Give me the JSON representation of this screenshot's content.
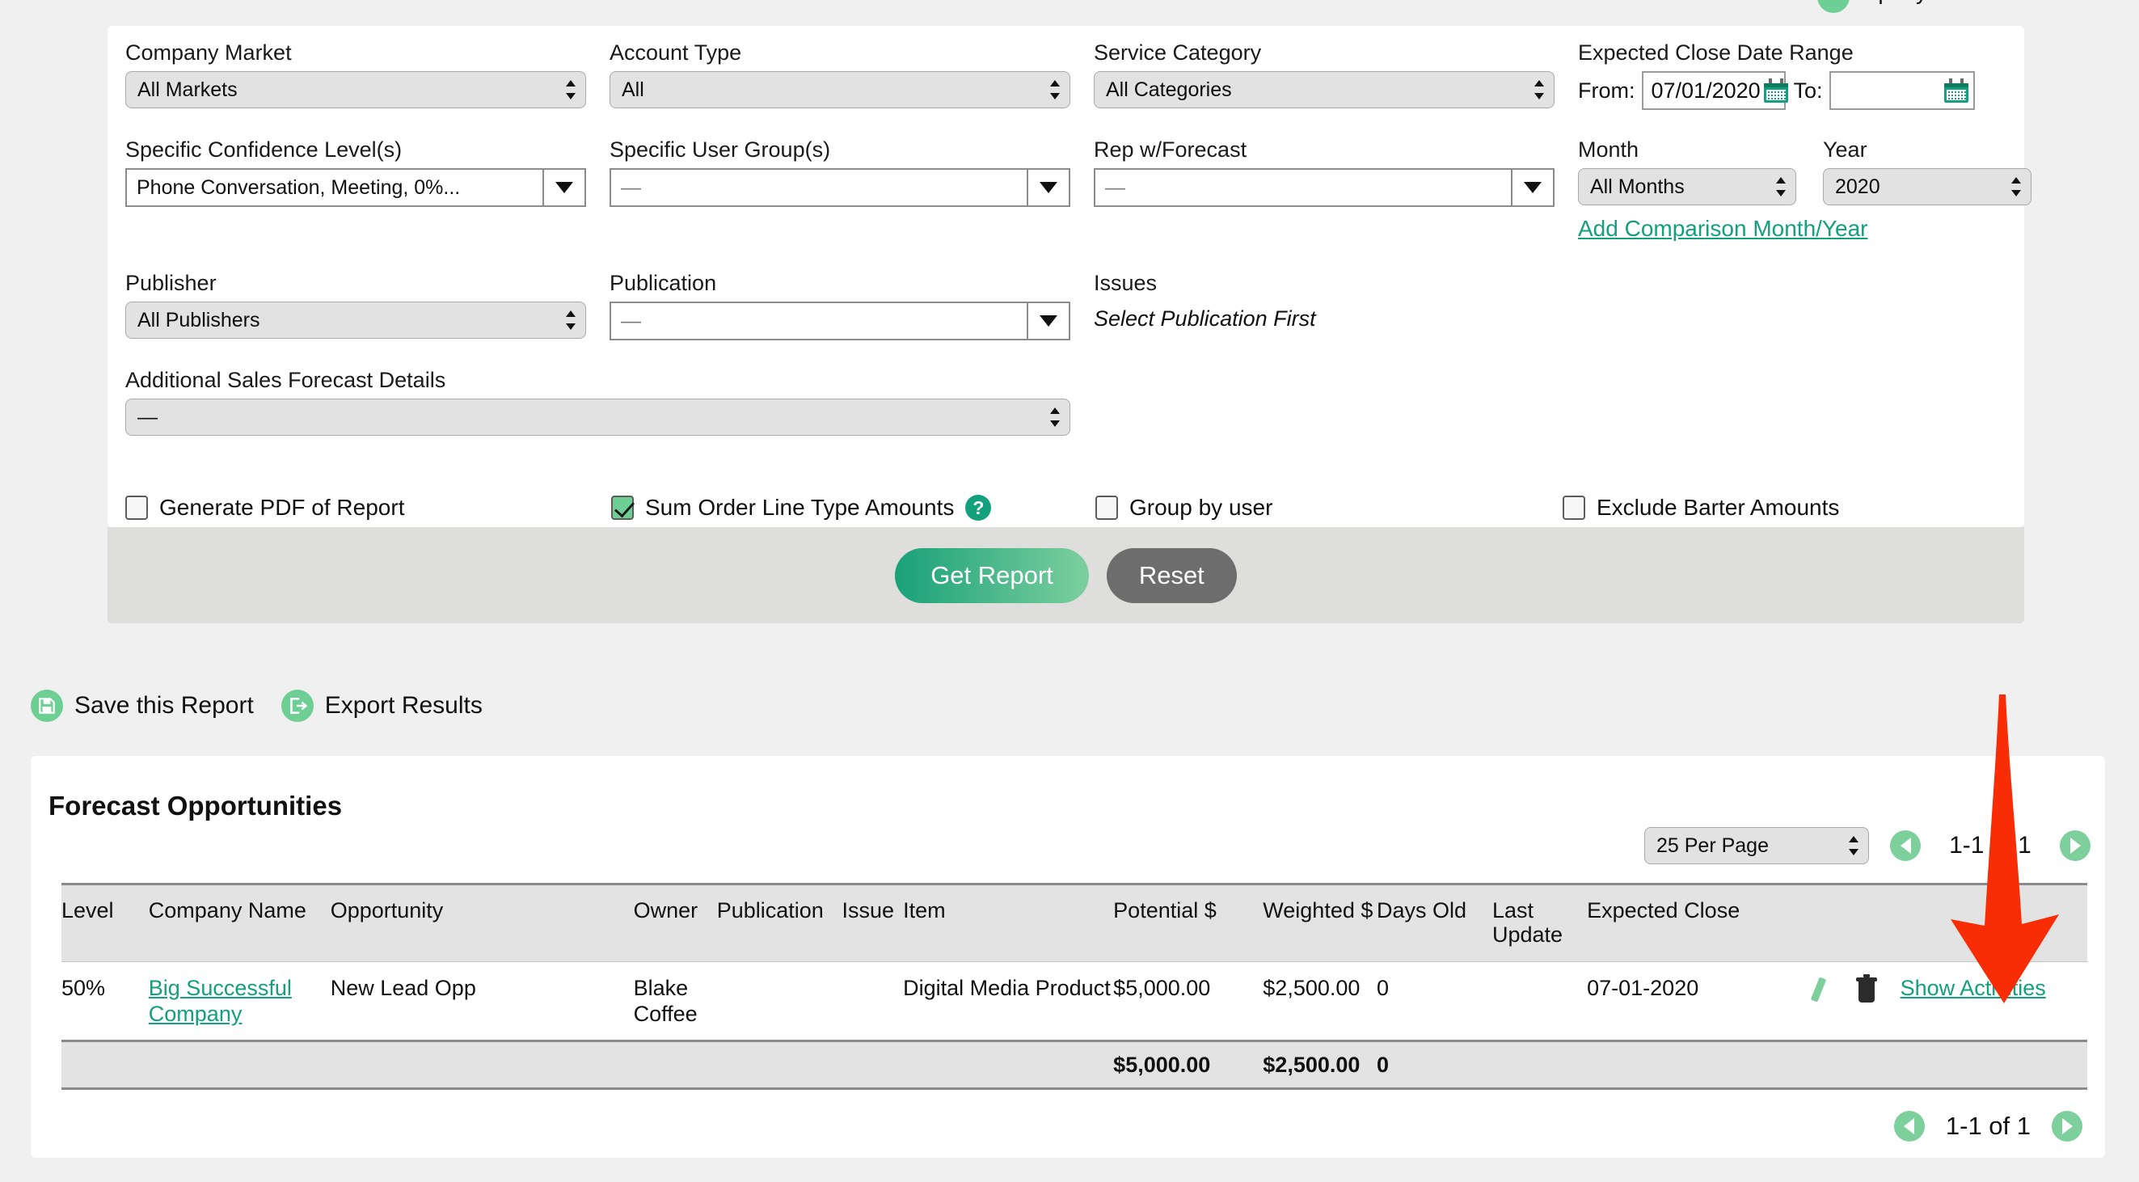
{
  "top_cut": {
    "label": "mpany"
  },
  "filters": {
    "company_market": {
      "label": "Company Market",
      "value": "All Markets"
    },
    "account_type": {
      "label": "Account Type",
      "value": "All"
    },
    "service_category": {
      "label": "Service Category",
      "value": "All Categories"
    },
    "expected_close": {
      "label": "Expected Close Date Range",
      "from_label": "From:",
      "from_value": "07/01/2020",
      "to_label": "To:",
      "to_value": ""
    },
    "confidence": {
      "label": "Specific Confidence Level(s)",
      "value": "Phone Conversation, Meeting, 0%..."
    },
    "user_groups": {
      "label": "Specific User Group(s)",
      "value": "—"
    },
    "rep_forecast": {
      "label": "Rep w/Forecast",
      "value": "—"
    },
    "month": {
      "label": "Month",
      "value": "All Months"
    },
    "year": {
      "label": "Year",
      "value": "2020"
    },
    "add_comparison": "Add Comparison Month/Year",
    "publisher": {
      "label": "Publisher",
      "value": "All Publishers"
    },
    "publication": {
      "label": "Publication",
      "value": "—"
    },
    "issues": {
      "label": "Issues",
      "note": "Select Publication First"
    },
    "additional_details": {
      "label": "Additional Sales Forecast Details",
      "value": "—"
    }
  },
  "checkboxes": [
    {
      "label": "Generate PDF of Report",
      "checked": false,
      "help": false
    },
    {
      "label": "Sum Order Line Type Amounts",
      "checked": true,
      "help": true,
      "help_glyph": "?"
    },
    {
      "label": "Group by user",
      "checked": false,
      "help": false
    },
    {
      "label": "Exclude Barter Amounts",
      "checked": false,
      "help": false
    }
  ],
  "buttons": {
    "get_report": "Get Report",
    "reset": "Reset"
  },
  "actions": [
    {
      "label": "Save this Report",
      "icon": "save-disk-icon"
    },
    {
      "label": "Export Results",
      "icon": "export-icon"
    }
  ],
  "results": {
    "title": "Forecast Opportunities",
    "per_page": "25 Per Page",
    "page_count_top": "1-1 of 1",
    "page_count_bottom": "1-1 of 1",
    "columns": [
      "Level",
      "Company Name",
      "Opportunity",
      "Owner",
      "Publication",
      "Issue",
      "Item",
      "Potential $",
      "Weighted $",
      "Days Old",
      "Last Update",
      "Expected Close",
      ""
    ],
    "rows": [
      {
        "level": "50%",
        "company": "Big Successful Company",
        "opportunity": "New Lead Opp",
        "owner": "Blake Coffee",
        "publication": "",
        "issue": "",
        "item": "Digital Media Product",
        "potential": "$5,000.00",
        "weighted": "$2,500.00",
        "days_old": "0",
        "last_update": "",
        "expected_close": "07-01-2020",
        "show_activities": "Show Activities"
      }
    ],
    "totals": {
      "potential": "$5,000.00",
      "weighted": "$2,500.00",
      "days_old": "0"
    }
  },
  "colors": {
    "green": "#12a07d",
    "green_light": "#7dcf9b",
    "red_arrow": "#f92d05",
    "grey_button": "#6d6d6d"
  }
}
